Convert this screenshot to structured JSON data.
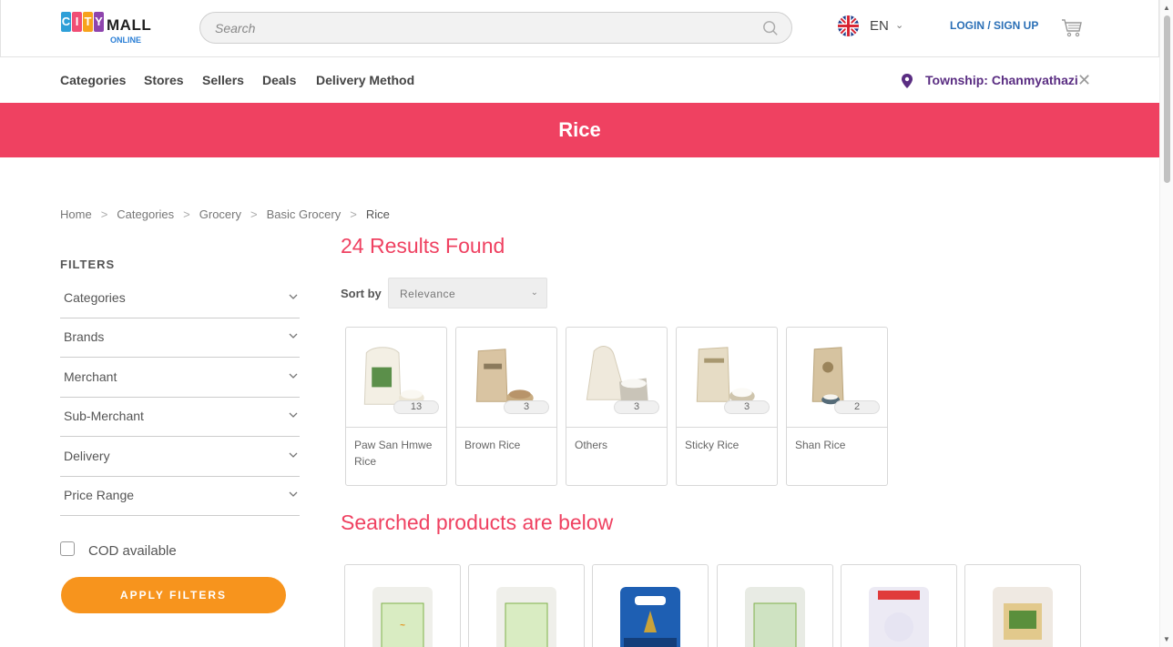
{
  "header": {
    "logo": {
      "letters": [
        "C",
        "I",
        "T",
        "Y"
      ],
      "mall": "MALL",
      "online": "ONLINE",
      "letter_colors": [
        "#2e9fd8",
        "#f04e75",
        "#f7a21b",
        "#8e44ad"
      ]
    },
    "search": {
      "placeholder": "Search"
    },
    "language": {
      "code": "EN"
    },
    "login": "LOGIN / SIGN UP"
  },
  "nav": {
    "items": [
      "Categories",
      "Stores",
      "Sellers",
      "Deals",
      "Delivery Method"
    ],
    "township": "Township: Chanmyathazi"
  },
  "banner": {
    "title": "Rice",
    "color": "#ef4161"
  },
  "breadcrumb": [
    "Home",
    "Categories",
    "Grocery",
    "Basic Grocery",
    "Rice"
  ],
  "filters": {
    "title": "FILTERS",
    "items": [
      "Categories",
      "Brands",
      "Merchant",
      "Sub-Merchant",
      "Delivery",
      "Price Range"
    ],
    "cod": "COD available",
    "apply": "APPLY FILTERS"
  },
  "results": {
    "heading": "24 Results Found",
    "sort_label": "Sort by",
    "sort_value": "Relevance"
  },
  "categories": [
    {
      "name": "Paw San Hmwe Rice",
      "count": "13"
    },
    {
      "name": "Brown Rice",
      "count": "3"
    },
    {
      "name": "Others",
      "count": "3"
    },
    {
      "name": "Sticky Rice",
      "count": "3"
    },
    {
      "name": "Shan Rice",
      "count": "2"
    }
  ],
  "searched_heading": "Searched products are below",
  "accent": "#ef4161",
  "button_color": "#f7941d"
}
